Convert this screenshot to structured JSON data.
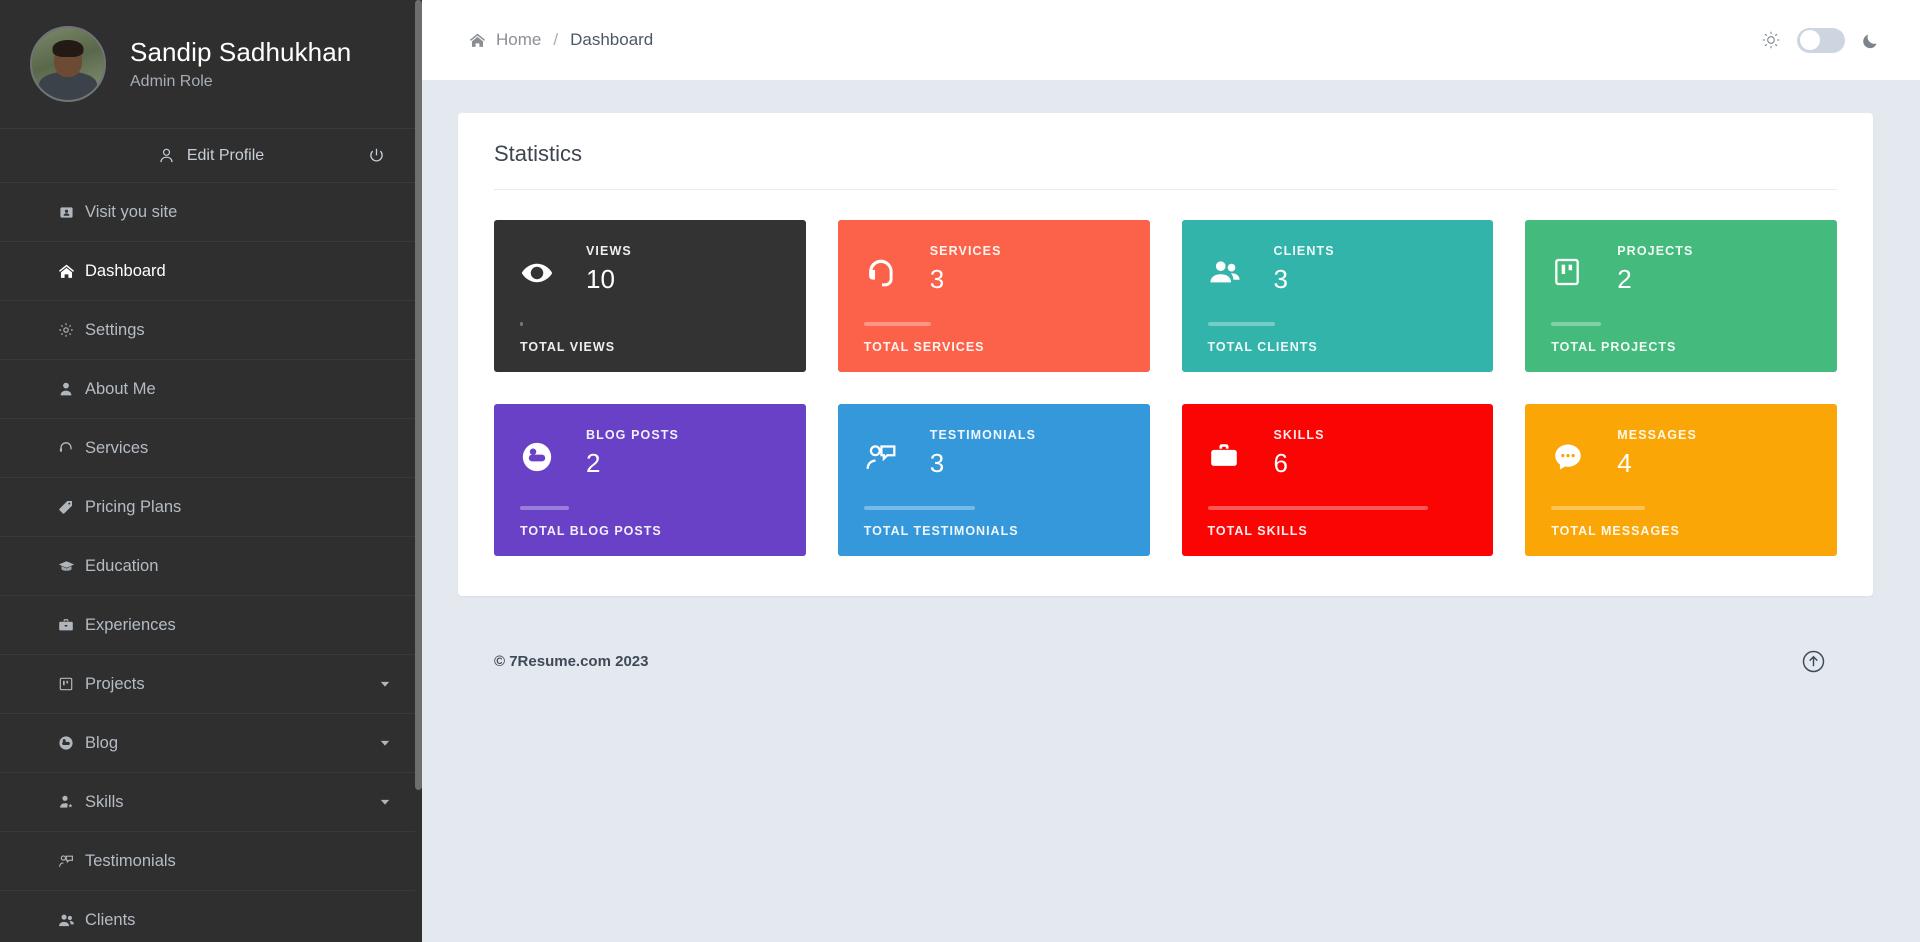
{
  "sidebar": {
    "profile": {
      "name": "Sandip Sadhukhan",
      "role": "Admin Role",
      "avatar_icon": "user-avatar-photo"
    },
    "edit_profile_label": "Edit Profile",
    "edit_profile_icon": "user-icon",
    "logout_icon": "power-icon",
    "items": [
      {
        "label": "Visit you site",
        "icon": "id-card-icon",
        "active": false,
        "expandable": false
      },
      {
        "label": "Dashboard",
        "icon": "home-icon",
        "active": true,
        "expandable": false
      },
      {
        "label": "Settings",
        "icon": "gear-icon",
        "active": false,
        "expandable": false
      },
      {
        "label": "About Me",
        "icon": "person-icon",
        "active": false,
        "expandable": false
      },
      {
        "label": "Services",
        "icon": "headset-icon",
        "active": false,
        "expandable": false
      },
      {
        "label": "Pricing Plans",
        "icon": "tag-icon",
        "active": false,
        "expandable": false
      },
      {
        "label": "Education",
        "icon": "graduation-cap-icon",
        "active": false,
        "expandable": false
      },
      {
        "label": "Experiences",
        "icon": "briefcase-icon",
        "active": false,
        "expandable": false
      },
      {
        "label": "Projects",
        "icon": "kanban-icon",
        "active": false,
        "expandable": true
      },
      {
        "label": "Blog",
        "icon": "blogger-icon",
        "active": false,
        "expandable": true
      },
      {
        "label": "Skills",
        "icon": "person-star-icon",
        "active": false,
        "expandable": true
      },
      {
        "label": "Testimonials",
        "icon": "person-quote-icon",
        "active": false,
        "expandable": false
      },
      {
        "label": "Clients",
        "icon": "people-icon",
        "active": false,
        "expandable": false
      }
    ],
    "chevron_icon": "chevron-down-icon"
  },
  "topbar": {
    "breadcrumb": {
      "home_icon": "home-icon",
      "home_label": "Home",
      "separator": "/",
      "current_label": "Dashboard"
    },
    "theme": {
      "sun_icon": "sun-icon",
      "moon_icon": "moon-icon",
      "toggle_state": "light"
    }
  },
  "main": {
    "panel_title": "Statistics",
    "stats": [
      {
        "label": "VIEWS",
        "value": "10",
        "footer": "TOTAL VIEWS",
        "icon": "eye-icon",
        "color": "#333333",
        "bar_percent": 1
      },
      {
        "label": "SERVICES",
        "value": "3",
        "footer": "TOTAL SERVICES",
        "icon": "headset-icon",
        "color": "#fc6249",
        "bar_percent": 26
      },
      {
        "label": "CLIENTS",
        "value": "3",
        "footer": "TOTAL CLIENTS",
        "icon": "people-icon",
        "color": "#33b4ab",
        "bar_percent": 26
      },
      {
        "label": "PROJECTS",
        "value": "2",
        "footer": "TOTAL PROJECTS",
        "icon": "kanban-icon",
        "color": "#44bb7d",
        "bar_percent": 19
      },
      {
        "label": "BLOG POSTS",
        "value": "2",
        "footer": "TOTAL BLOG POSTS",
        "icon": "blogger-icon",
        "color": "#6841c6",
        "bar_percent": 19
      },
      {
        "label": "TESTIMONIALS",
        "value": "3",
        "footer": "TOTAL TESTIMONIALS",
        "icon": "person-quote-icon",
        "color": "#3498db",
        "bar_percent": 43
      },
      {
        "label": "SKILLS",
        "value": "6",
        "footer": "TOTAL SKILLS",
        "icon": "briefcase-icon",
        "color": "#fb0404",
        "bar_percent": 85
      },
      {
        "label": "MESSAGES",
        "value": "4",
        "footer": "TOTAL MESSAGES",
        "icon": "chat-dots-icon",
        "color": "#f9a606",
        "bar_percent": 36
      }
    ]
  },
  "footer": {
    "copyright": "© 7Resume.com 2023",
    "scroll_top_icon": "arrow-up-circle-icon"
  }
}
